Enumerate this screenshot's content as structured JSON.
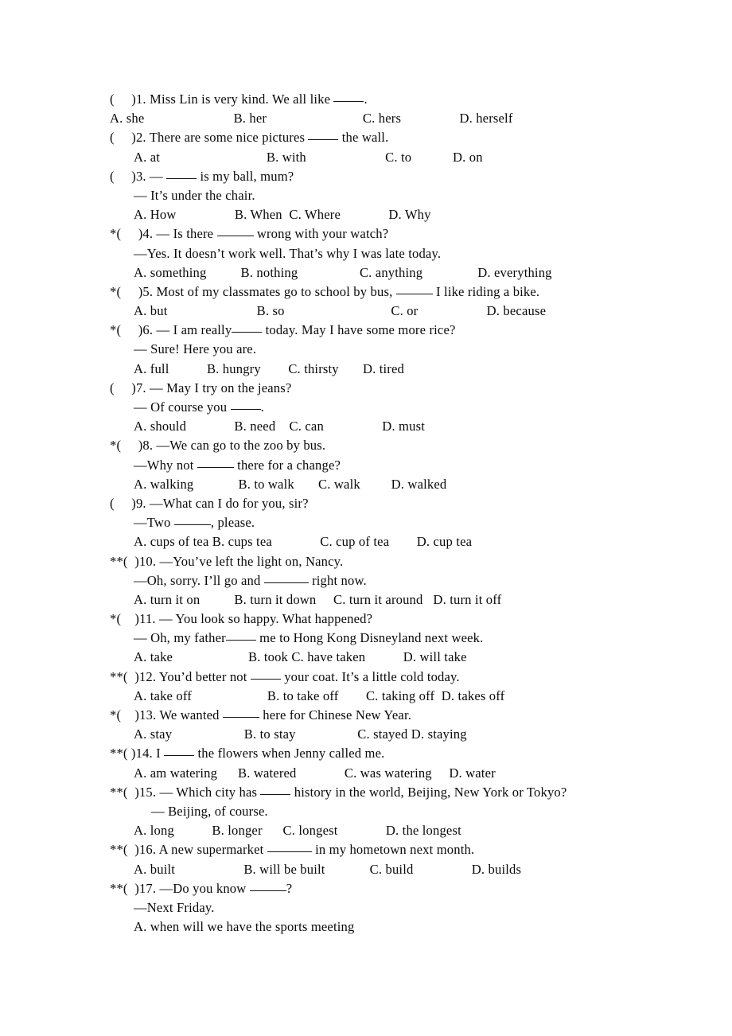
{
  "document": {
    "type": "english-grammar-multiple-choice-worksheet",
    "page_background": "#ffffff",
    "text_color": "#0a0a0a"
  },
  "questions": [
    {
      "stars": "(",
      "number": ")1.",
      "stem": " Miss Lin is very kind. We all like ",
      "stem_tail": ".",
      "extra_lines": [],
      "options": [
        "A. she",
        "B. her",
        "C. hers",
        "D. herself"
      ],
      "options_indent": "flush"
    },
    {
      "stars": "(",
      "number": ")2.",
      "stem": " There are some nice pictures ",
      "stem_tail": " the wall.",
      "extra_lines": [],
      "options": [
        "A. at",
        "B. with",
        "C. to",
        "D. on"
      ],
      "options_indent": "normal"
    },
    {
      "stars": "(",
      "number": ")3.",
      "stem": " — ",
      "stem_tail": " is my ball, mum?",
      "extra_lines": [
        "— It’s under the chair."
      ],
      "options": [
        "A. How",
        "B. When",
        "C. Where",
        "D. Why"
      ],
      "options_indent": "normal"
    },
    {
      "stars": "*(",
      "number": ")4.",
      "stem": " — Is there ",
      "stem_tail": " wrong with your watch?",
      "extra_lines": [
        "—Yes. It doesn’t work well. That’s why I was late today."
      ],
      "options": [
        "A. something",
        "B. nothing",
        "C. anything",
        "D. everything"
      ],
      "options_indent": "normal"
    },
    {
      "stars": "*(",
      "number": ")5.",
      "stem": " Most of my classmates go to school by bus, ",
      "stem_tail": " I like riding a bike.",
      "extra_lines": [],
      "options": [
        "A. but",
        "B. so",
        "C. or",
        "D. because"
      ],
      "options_indent": "normal"
    },
    {
      "stars": "*(",
      "number": ")6.",
      "stem": " — I am really",
      "stem_tail": " today. May I have some more rice?",
      "extra_lines": [
        "— Sure! Here you are."
      ],
      "options": [
        "A. full",
        "B. hungry",
        "C. thirsty",
        "D. tired"
      ],
      "options_indent": "normal"
    },
    {
      "stars": "(",
      "number": ")7.",
      "stem": " — May I try on the jeans?",
      "stem_tail": "",
      "extra_lines": [
        "— Of course you ____."
      ],
      "options": [
        "A. should",
        "B. need",
        "C. can",
        "D. must"
      ],
      "options_indent": "normal"
    },
    {
      "stars": "*(",
      "number": ")8.",
      "stem": " —We can go to the zoo by bus.",
      "stem_tail": "",
      "extra_lines": [
        "—Why not ______ there for a change?"
      ],
      "options": [
        "A. walking",
        "B. to walk",
        "C. walk",
        "D. walked"
      ],
      "options_indent": "normal"
    },
    {
      "stars": "(",
      "number": ")9.",
      "stem": " —What can I do for you, sir?",
      "stem_tail": "",
      "extra_lines": [
        "—Two ______, please."
      ],
      "options": [
        "A. cups of tea",
        "B. cups tea",
        "C. cup of tea",
        "D. cup tea"
      ],
      "options_indent": "normal"
    },
    {
      "stars": "**(",
      "number": ")10.",
      "stem": " —You’ve left the light on, Nancy.",
      "stem_tail": "",
      "extra_lines": [
        "—Oh, sorry. I’ll go and _______ right now."
      ],
      "options": [
        "A. turn it on",
        "B. turn it down",
        "C. turn it around",
        "D. turn it off"
      ],
      "options_indent": "normal"
    },
    {
      "stars": "*(",
      "number": ")11.",
      "stem": " — You look so happy. What happened?",
      "stem_tail": "",
      "extra_lines": [
        "— Oh, my father_____ me to Hong Kong Disneyland next week."
      ],
      "options": [
        "A. take",
        "B. took",
        "C. have taken",
        "D. will take"
      ],
      "options_indent": "normal"
    },
    {
      "stars": "**(",
      "number": ")12.",
      "stem": " You’d better not ",
      "stem_tail": " your coat. It’s a little cold today.",
      "extra_lines": [],
      "options": [
        "A. take off",
        "B. to take off",
        "C. taking off",
        "D. takes off"
      ],
      "options_indent": "normal"
    },
    {
      "stars": "*(",
      "number": ")13.",
      "stem": " We wanted ",
      "stem_tail": " here for Chinese New Year.",
      "extra_lines": [],
      "options": [
        "A. stay",
        "B. to stay",
        "C. stayed",
        "D. staying"
      ],
      "options_indent": "normal"
    },
    {
      "stars": "**(",
      "number": ")14.",
      "stem": " I",
      "stem_tail": " the flowers when Jenny called me.",
      "extra_lines": [],
      "options": [
        "A. am watering",
        "B. watered",
        "C. was watering",
        "D. water"
      ],
      "options_indent": "normal"
    },
    {
      "stars": "**(",
      "number": ")15.",
      "stem": " — Which city has ",
      "stem_tail": " history in the world, Beijing, New York or Tokyo?",
      "extra_lines": [
        "— Beijing, of course."
      ],
      "options": [
        "A. long",
        "B. longer",
        "C. longest",
        "D. the longest"
      ],
      "options_indent": "normal"
    },
    {
      "stars": "**(",
      "number": ")16.",
      "stem": " A new supermarket ",
      "stem_tail": " in my hometown next month.",
      "extra_lines": [],
      "options": [
        "A. built",
        "B. will be built",
        "C. build",
        "D. builds"
      ],
      "options_indent": "normal"
    },
    {
      "stars": "**(",
      "number": ")17.",
      "stem": " —Do you know ",
      "stem_tail": "?",
      "extra_lines": [
        "—Next Friday."
      ],
      "options": [
        "A. when will we have the sports meeting"
      ],
      "options_indent": "normal"
    }
  ],
  "lines": [
    {
      "id": "q1-stem",
      "indent": 0,
      "text": "(     )1. Miss Lin is very kind. We all like _____."
    },
    {
      "id": "q1-options",
      "indent": 0,
      "text": "A. she                          B. her                            C. hers                 D. herself"
    },
    {
      "id": "q2-stem",
      "indent": 0,
      "text": "(     )2. There are some nice pictures _____ the wall."
    },
    {
      "id": "q2-options",
      "indent": 1,
      "text": "A. at                               B. with                       C. to            D. on"
    },
    {
      "id": "q3-stem",
      "indent": 0,
      "text": "(     )3. — _____ is my ball, mum?"
    },
    {
      "id": "q3-reply",
      "indent": 1,
      "text": "— It’s under the chair."
    },
    {
      "id": "q3-options",
      "indent": 1,
      "text": "A. How                 B. When  C. Where              D. Why"
    },
    {
      "id": "q4-stem",
      "indent": 0,
      "text": "*(     )4. — Is there ______ wrong with your watch?"
    },
    {
      "id": "q4-reply",
      "indent": 1,
      "text": "—Yes. It doesn’t work well. That’s why I was late today."
    },
    {
      "id": "q4-options",
      "indent": 1,
      "text": "A. something          B. nothing                  C. anything                D. everything"
    },
    {
      "id": "q5-stem",
      "indent": 0,
      "text": "*(     )5. Most of my classmates go to school by bus, ______ I like riding a bike."
    },
    {
      "id": "q5-options",
      "indent": 1,
      "text": "A. but                          B. so                               C. or                    D. because"
    },
    {
      "id": "q6-stem",
      "indent": 0,
      "text": "*(     )6. — I am really_____ today. May I have some more rice?"
    },
    {
      "id": "q6-reply",
      "indent": 1,
      "text": "— Sure! Here you are."
    },
    {
      "id": "q6-options",
      "indent": 1,
      "text": "A. full           B. hungry        C. thirsty       D. tired"
    },
    {
      "id": "q7-stem",
      "indent": 0,
      "text": "(     )7. — May I try on the jeans?"
    },
    {
      "id": "q7-reply",
      "indent": 1,
      "text": "— Of course you _____."
    },
    {
      "id": "q7-options",
      "indent": 1,
      "text": "A. should              B. need    C. can                 D. must"
    },
    {
      "id": "q8-stem",
      "indent": 0,
      "text": "*(     )8. —We can go to the zoo by bus."
    },
    {
      "id": "q8-reply",
      "indent": 1,
      "text": "—Why not ______ there for a change?"
    },
    {
      "id": "q8-options",
      "indent": 1,
      "text": "A. walking             B. to walk       C. walk         D. walked"
    },
    {
      "id": "q9-stem",
      "indent": 0,
      "text": "(     )9. —What can I do for you, sir?"
    },
    {
      "id": "q9-reply",
      "indent": 1,
      "text": "—Two ______, please."
    },
    {
      "id": "q9-options",
      "indent": 1,
      "text": "A. cups of tea B. cups tea              C. cup of tea        D. cup tea"
    },
    {
      "id": "q10-stem",
      "indent": 0,
      "text": "**(  )10. —You’ve left the light on, Nancy."
    },
    {
      "id": "q10-reply",
      "indent": 1,
      "text": "—Oh, sorry. I’ll go and _______ right now."
    },
    {
      "id": "q10-options",
      "indent": 1,
      "text": "A. turn it on          B. turn it down     C. turn it around   D. turn it off"
    },
    {
      "id": "q11-stem",
      "indent": 0,
      "text": "*(    )11. — You look so happy. What happened?"
    },
    {
      "id": "q11-reply",
      "indent": 1,
      "text": "— Oh, my father_____ me to Hong Kong Disneyland next week."
    },
    {
      "id": "q11-options",
      "indent": 1,
      "text": "A. take                      B. took C. have taken           D. will take"
    },
    {
      "id": "q12-stem",
      "indent": 0,
      "text": "**(  )12. You’d better not _____ your coat. It’s a little cold today."
    },
    {
      "id": "q12-options",
      "indent": 1,
      "text": "A. take off                      B. to take off        C. taking off  D. takes off"
    },
    {
      "id": "q13-stem",
      "indent": 0,
      "text": "*(    )13. We wanted ______ here for Chinese New Year."
    },
    {
      "id": "q13-options",
      "indent": 1,
      "text": "A. stay                     B. to stay                  C. stayed D. staying"
    },
    {
      "id": "q14-stem",
      "indent": 0,
      "text": "**( )14. I _____ the flowers when Jenny called me."
    },
    {
      "id": "q14-options",
      "indent": 1,
      "text": "A. am watering      B. watered              C. was watering     D. water"
    },
    {
      "id": "q15-stem",
      "indent": 0,
      "text": "**(  )15. — Which city has _____ history in the world, Beijing, New York or Tokyo?"
    },
    {
      "id": "q15-reply",
      "indent": 2,
      "text": "— Beijing, of course."
    },
    {
      "id": "q15-options",
      "indent": 1,
      "text": "A. long           B. longer      C. longest              D. the longest"
    },
    {
      "id": "q16-stem",
      "indent": 0,
      "text": "**(  )16. A new supermarket _______ in my hometown next month."
    },
    {
      "id": "q16-options",
      "indent": 1,
      "text": "A. built                    B. will be built             C. build                 D. builds"
    },
    {
      "id": "q17-stem",
      "indent": 0,
      "text": "**(  )17. —Do you know ______?"
    },
    {
      "id": "q17-reply",
      "indent": 1,
      "text": "—Next Friday."
    },
    {
      "id": "q17-options",
      "indent": 1,
      "text": "A. when will we have the sports meeting"
    }
  ]
}
